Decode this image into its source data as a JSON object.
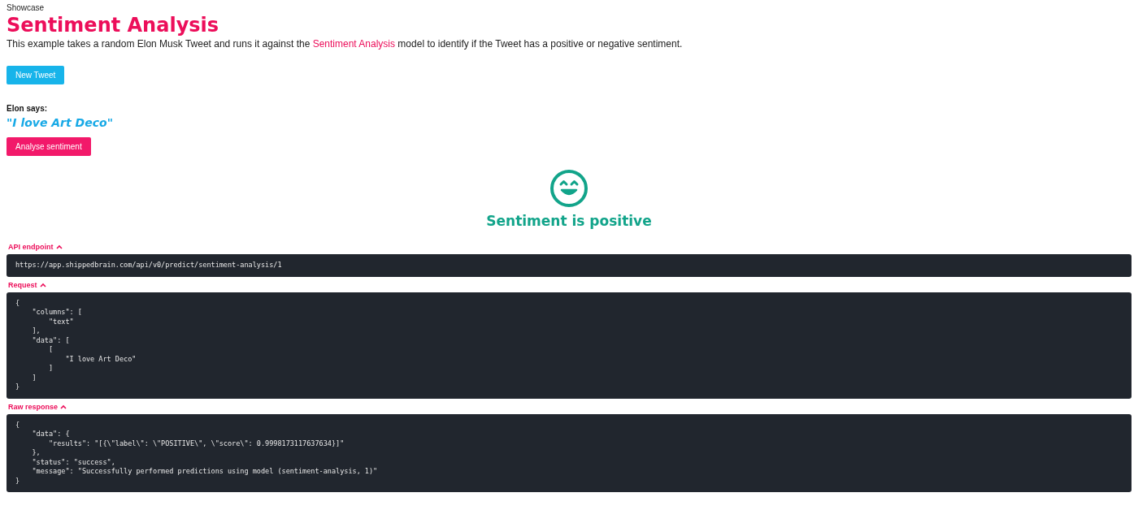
{
  "breadcrumb": "Showcase",
  "title": "Sentiment Analysis",
  "description": {
    "before": "This example takes a random Elon Musk Tweet and runs it against the ",
    "link": "Sentiment Analysis",
    "after": " model to identify if the Tweet has a positive or negative sentiment."
  },
  "new_tweet_button": "New Tweet",
  "tweet": {
    "label": "Elon says:",
    "text": "\"I love Art Deco\""
  },
  "analyse_button": "Analyse sentiment",
  "result": {
    "kind": "positive",
    "text": "Sentiment is positive"
  },
  "sections": [
    {
      "title": "API endpoint",
      "expanded": true,
      "lines": [
        "https://app.shippedbrain.com/api/v0/predict/sentiment-analysis/1"
      ]
    },
    {
      "title": "Request",
      "expanded": true,
      "lines": [
        "{",
        "    \"columns\": [",
        "        \"text\"",
        "    ],",
        "    \"data\": [",
        "        [",
        "            \"I love Art Deco\"",
        "        ]",
        "    ]",
        "}"
      ]
    },
    {
      "title": "Raw response",
      "expanded": true,
      "lines": [
        "{",
        "    \"data\": {",
        "        \"results\": \"[{\\\"label\\\": \\\"POSITIVE\\\", \\\"score\\\": 0.9998173117637634}]\"",
        "    },",
        "    \"status\": \"success\",",
        "    \"message\": \"Successfully performed predictions using model (sentiment-analysis, 1)\"",
        "}"
      ]
    }
  ]
}
